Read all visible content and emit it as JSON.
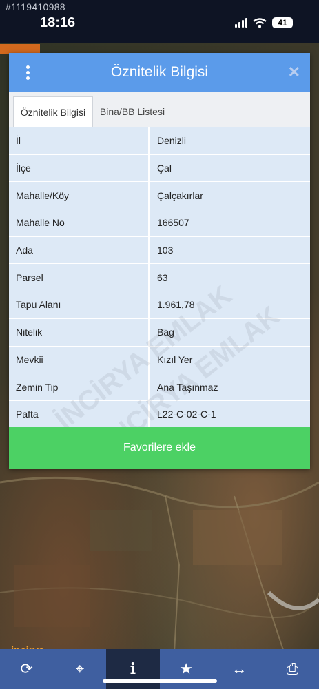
{
  "watermark_id": "#1119410988",
  "status": {
    "time": "18:16",
    "battery": "41"
  },
  "dialog": {
    "title": "Öznitelik Bilgisi",
    "tabs": [
      {
        "label": "Öznitelik Bilgisi",
        "active": true
      },
      {
        "label": "Bina/BB Listesi",
        "active": false
      }
    ],
    "rows": [
      {
        "key": "İl",
        "value": "Denizli"
      },
      {
        "key": "İlçe",
        "value": "Çal"
      },
      {
        "key": "Mahalle/Köy",
        "value": "Çalçakırlar"
      },
      {
        "key": "Mahalle No",
        "value": "166507"
      },
      {
        "key": "Ada",
        "value": "103"
      },
      {
        "key": "Parsel",
        "value": "63"
      },
      {
        "key": "Tapu Alanı",
        "value": "1.961,78"
      },
      {
        "key": "Nitelik",
        "value": "Bag"
      },
      {
        "key": "Mevkii",
        "value": "Kızıl Yer"
      },
      {
        "key": "Zemin Tip",
        "value": "Ana Taşınmaz"
      },
      {
        "key": "Pafta",
        "value": "L22-C-02-C-1"
      }
    ],
    "favorite_button": "Favorilere ekle"
  },
  "watermarks": [
    "İNCİRYA EMLAK",
    "İNCİRYA EMLAK"
  ],
  "logo_text": "incirya",
  "bottom_nav": [
    {
      "icon": "refresh-icon",
      "glyph": "⟳"
    },
    {
      "icon": "locate-icon",
      "glyph": "⌖"
    },
    {
      "icon": "info-icon",
      "glyph": "i"
    },
    {
      "icon": "star-icon",
      "glyph": "★"
    },
    {
      "icon": "measure-icon",
      "glyph": "↔"
    },
    {
      "icon": "print-icon",
      "glyph": "⎙"
    }
  ],
  "colors": {
    "header": "#5b9bea",
    "button": "#4cd164",
    "row": "#dde9f6",
    "nav": "#3f5fa0"
  }
}
